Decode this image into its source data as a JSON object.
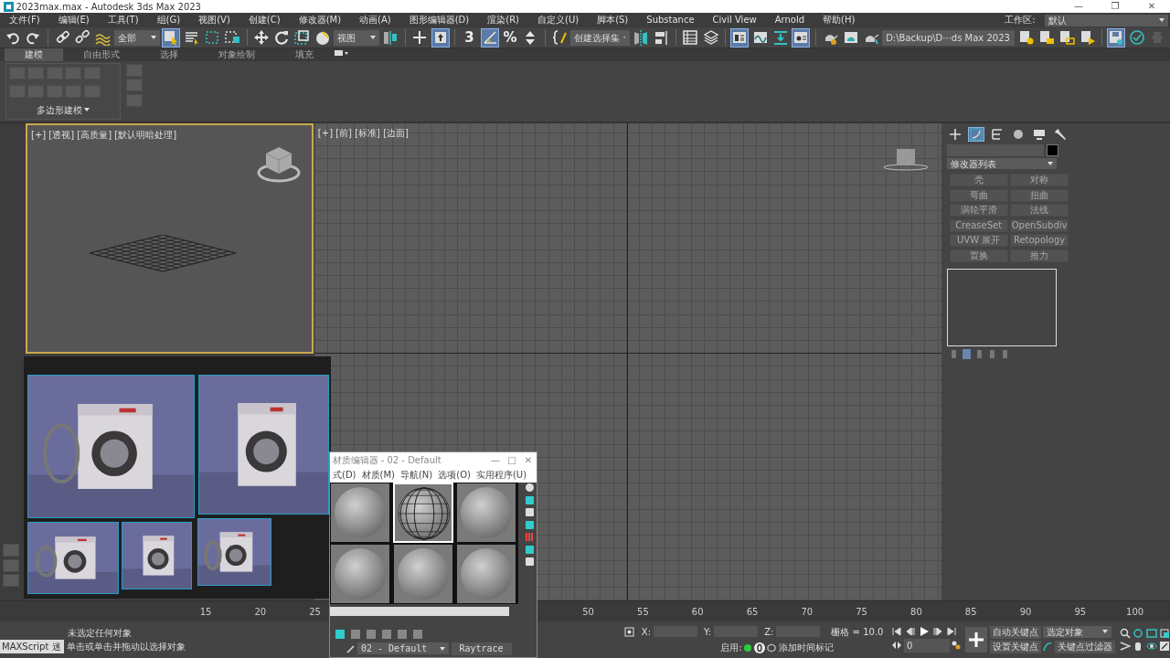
{
  "window": {
    "title": "2023max.max - Autodesk 3ds Max 2023",
    "controls": [
      "—",
      "❐",
      "✕"
    ]
  },
  "menu": [
    "文件(F)",
    "编辑(E)",
    "工具(T)",
    "组(G)",
    "视图(V)",
    "创建(C)",
    "修改器(M)",
    "动画(A)",
    "图形编辑器(D)",
    "渲染(R)",
    "自定义(U)",
    "脚本(S)",
    "Substance",
    "Civil View",
    "Arnold",
    "帮助(H)"
  ],
  "workspace": {
    "label": "工作区:",
    "value": "默认"
  },
  "toolbar": [
    {
      "kind": "button",
      "active": false
    },
    {
      "kind": "button",
      "active": false
    },
    {
      "kind": "sep"
    },
    {
      "kind": "button",
      "active": false
    },
    {
      "kind": "button",
      "active": false
    },
    {
      "kind": "button",
      "active": false
    },
    {
      "kind": "dropdown",
      "value": "全部"
    },
    {
      "kind": "button",
      "active": true
    },
    {
      "kind": "button",
      "active": false
    },
    {
      "kind": "button",
      "active": false
    },
    {
      "kind": "button",
      "active": false
    },
    {
      "kind": "sep"
    },
    {
      "kind": "button",
      "active": false
    },
    {
      "kind": "button",
      "active": false
    },
    {
      "kind": "button",
      "active": false
    },
    {
      "kind": "button",
      "active": false
    },
    {
      "kind": "dropdown",
      "value": "视图"
    },
    {
      "kind": "button",
      "active": false
    },
    {
      "kind": "sep"
    },
    {
      "kind": "button",
      "active": false
    },
    {
      "kind": "button",
      "active": true
    },
    {
      "kind": "sep"
    },
    {
      "kind": "text",
      "label": "3",
      "active": false
    },
    {
      "kind": "button",
      "active": true
    },
    {
      "kind": "text",
      "label": "%",
      "active": false
    },
    {
      "kind": "button",
      "active": false
    },
    {
      "kind": "sep"
    },
    {
      "kind": "button",
      "active": false
    },
    {
      "kind": "dropdown",
      "value": "创建选择集"
    },
    {
      "kind": "button",
      "active": false
    },
    {
      "kind": "button",
      "active": false
    },
    {
      "kind": "sep"
    },
    {
      "kind": "button",
      "active": false
    },
    {
      "kind": "button",
      "active": false
    },
    {
      "kind": "sep"
    },
    {
      "kind": "button",
      "active": true
    },
    {
      "kind": "button",
      "active": false
    },
    {
      "kind": "button",
      "active": false
    },
    {
      "kind": "button",
      "active": true
    },
    {
      "kind": "sep"
    },
    {
      "kind": "button",
      "active": false
    },
    {
      "kind": "button",
      "active": false
    },
    {
      "kind": "button",
      "active": false
    },
    {
      "kind": "dropdown",
      "value": "D:\\Backup\\D···ds Max 2023"
    },
    {
      "kind": "button",
      "active": false
    },
    {
      "kind": "button",
      "active": false
    },
    {
      "kind": "button",
      "active": false
    },
    {
      "kind": "button",
      "active": false
    },
    {
      "kind": "sep"
    },
    {
      "kind": "button",
      "active": true
    },
    {
      "kind": "button",
      "active": false
    },
    {
      "kind": "button",
      "active": false
    }
  ],
  "ribbon": {
    "tabs": [
      {
        "label": "建模",
        "selected": true
      },
      {
        "label": "自由形式",
        "selected": false
      },
      {
        "label": "选择",
        "selected": false
      },
      {
        "label": "对象绘制",
        "selected": false
      },
      {
        "label": "填充",
        "selected": false
      }
    ],
    "panel_label": "多边形建模"
  },
  "viewports": [
    {
      "label": "[+] [透视] [高质量] [默认明暗处理]",
      "active": true
    },
    {
      "label": "[+] [前] [标准] [边面]",
      "active": false
    }
  ],
  "material_editor": {
    "title": "材质编辑器 - 02 - Default",
    "controls": [
      "—",
      "□",
      "✕"
    ],
    "menu": [
      "式(D)",
      "材质(M)",
      "导航(N)",
      "选项(O)",
      "实用程序(U)"
    ],
    "slots": [
      {
        "selected": false
      },
      {
        "selected": true
      },
      {
        "selected": false
      },
      {
        "selected": false
      },
      {
        "selected": false
      },
      {
        "selected": false
      }
    ],
    "material_name": "02 - Default",
    "material_type": "Raytrace"
  },
  "command_panel": {
    "tabs": [
      {
        "selected": false
      },
      {
        "selected": true
      },
      {
        "selected": false
      },
      {
        "selected": false
      },
      {
        "selected": false
      },
      {
        "selected": false
      }
    ],
    "modifier_list": "修改器列表",
    "modifiers": [
      "壳",
      "对称",
      "弯曲",
      "扭曲",
      "涡轮平滑",
      "法线",
      "CreaseSet",
      "OpenSubdiv",
      "UVW 展开",
      "Retopology",
      "置换",
      "推力"
    ]
  },
  "timeline": {
    "labels": [
      "15",
      "20",
      "25",
      "50",
      "55",
      "60",
      "65",
      "70",
      "75",
      "80",
      "85",
      "90",
      "95",
      "100"
    ]
  },
  "status_bar": {
    "maxscript": "MAXScript 迷",
    "prompt": "未选定任何对象",
    "hint": "单击或单击并拖动以选择对象",
    "x_label": "X:",
    "y_label": "Y:",
    "z_label": "Z:",
    "grid": "栅格 = 10.0",
    "enable_label": "启用:",
    "enabled": true,
    "time_tag": "添加时间标记",
    "frame": "0",
    "auto_key": "自动关键点",
    "key_mode": "选定对象",
    "set_key": "设置关键点",
    "key_filters": "关键点过滤器"
  }
}
